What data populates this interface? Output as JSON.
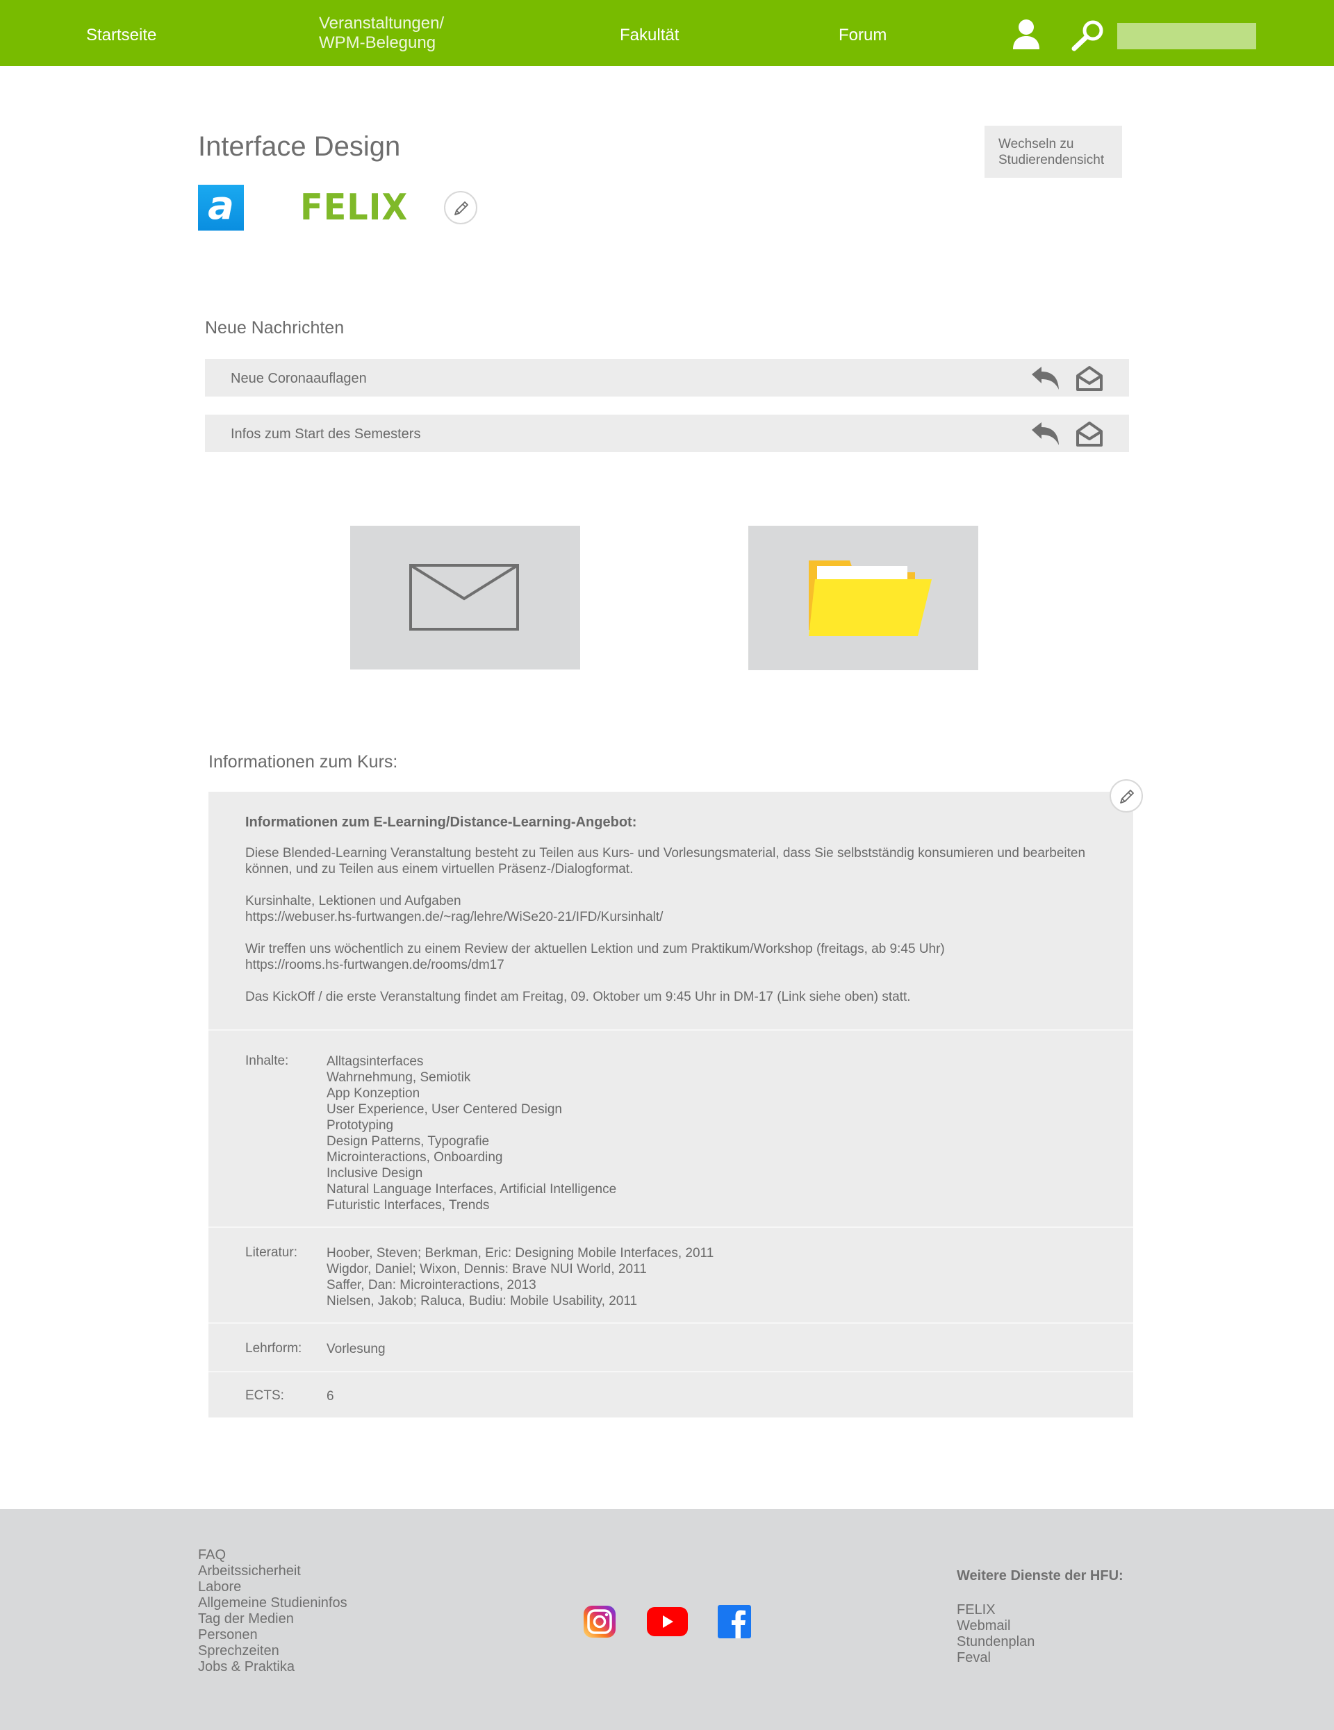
{
  "nav": {
    "start": "Startseite",
    "veranst_line1": "Veranstaltungen/",
    "veranst_line2": "WPM-Belegung",
    "fakultaet": "Fakultät",
    "forum": "Forum",
    "user_icon": "user-icon",
    "search_icon": "search-icon",
    "search_value": ""
  },
  "page": {
    "title": "Interface Design",
    "switch_line1": "Wechseln zu",
    "switch_line2": "Studierendensicht",
    "app_a_letter": "a",
    "felix": "FELIX"
  },
  "news": {
    "title": "Neue Nachrichten",
    "items": [
      {
        "label": "Neue Coronaauflagen"
      },
      {
        "label": "Infos zum Start des Semesters"
      }
    ]
  },
  "tiles": {
    "mail_icon": "envelope-icon",
    "folder_icon": "folder-icon"
  },
  "info": {
    "title": "Informationen zum Kurs:",
    "heading": "Informationen zum E-Learning/Distance-Learning-Angebot:",
    "p1": "Diese Blended-Learning Veranstaltung besteht zu Teilen aus Kurs- und Vorlesungsmaterial, dass Sie selbstständig konsumieren und bearbeiten können, und zu Teilen aus einem virtuellen Präsenz-/Dialogformat.",
    "p2_line1": "Kursinhalte, Lektionen und Aufgaben",
    "p2_line2": "https://webuser.hs-furtwangen.de/~rag/lehre/WiSe20-21/IFD/Kursinhalt/",
    "p3_line1": "Wir treffen uns wöchentlich zu einem Review der aktuellen Lektion und zum Praktikum/Workshop (freitags, ab 9:45 Uhr)",
    "p3_line2": "https://rooms.hs-furtwangen.de/rooms/dm17",
    "p4": "Das KickOff / die erste Veranstaltung findet am Freitag, 09. Oktober um 9:45 Uhr in DM-17 (Link siehe oben) statt.",
    "inhalte_label": "Inhalte:",
    "inhalte": [
      "Alltagsinterfaces",
      "Wahrnehmung, Semiotik",
      "App Konzeption",
      "User Experience, User Centered Design",
      "Prototyping",
      "Design Patterns, Typografie",
      "Microinteractions, Onboarding",
      "Inclusive Design",
      "Natural Language Interfaces, Artificial Intelligence",
      "Futuristic Interfaces, Trends"
    ],
    "literatur_label": "Literatur:",
    "literatur": [
      "Hoober, Steven; Berkman, Eric: Designing Mobile Interfaces, 2011",
      "Wigdor, Daniel; Wixon, Dennis: Brave NUI World, 2011",
      "Saffer, Dan: Microinteractions, 2013",
      "Nielsen, Jakob; Raluca, Budiu: Mobile Usability, 2011"
    ],
    "lehrform_label": "Lehrform:",
    "lehrform": "Vorlesung",
    "ects_label": "ECTS:",
    "ects": "6"
  },
  "footer": {
    "links": [
      "FAQ",
      "Arbeitssicherheit",
      "Labore",
      "Allgemeine Studieninfos",
      "Tag der Medien",
      "Personen",
      "Sprechzeiten",
      "Jobs & Praktika"
    ],
    "right_title": "Weitere Dienste der HFU:",
    "right_links": [
      "FELIX",
      "Webmail",
      "Stundenplan",
      "Feval"
    ],
    "social": [
      "instagram-icon",
      "youtube-icon",
      "facebook-icon"
    ]
  },
  "colors": {
    "brand_green": "#78bb00",
    "panel_grey": "#ececec",
    "footer_grey": "#d8d9da"
  }
}
